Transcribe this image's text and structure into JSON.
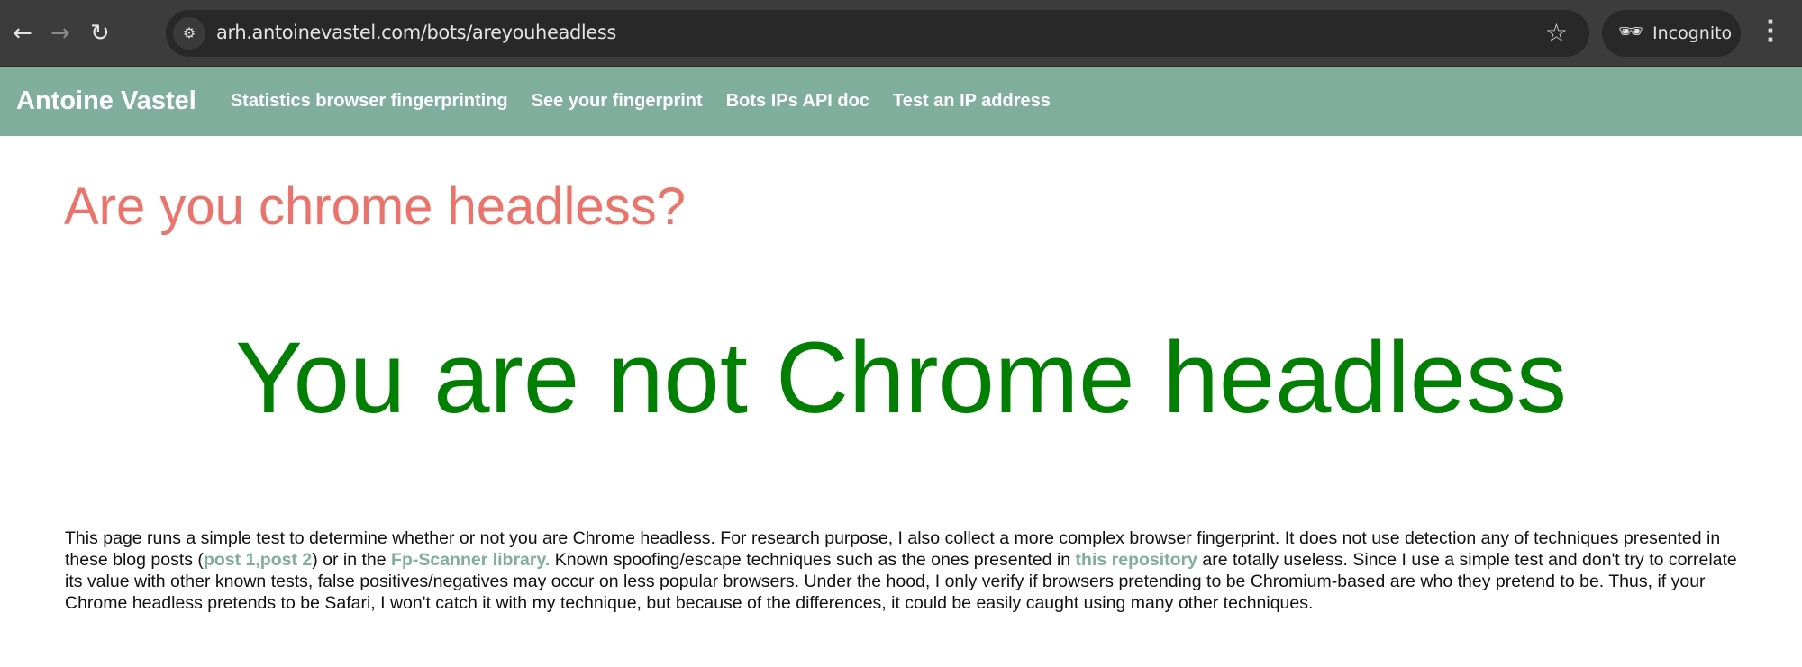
{
  "browser": {
    "url": "arh.antoinevastel.com/bots/areyouheadless",
    "profile_label": "Incognito"
  },
  "site_nav": {
    "brand": "Antoine Vastel",
    "links": [
      "Statistics browser fingerprinting",
      "See your fingerprint",
      "Bots IPs API doc",
      "Test an IP address"
    ]
  },
  "main": {
    "title": "Are you chrome headless?",
    "result": "You are not Chrome headless",
    "result_color": "#008000",
    "paragraph": {
      "t1": "This page runs a simple test to determine whether or not you are Chrome headless. For research purpose, I also collect a more complex browser fingerprint. It does not use detection any of techniques presented in these blog posts (",
      "link1": "post 1",
      "sep": ",",
      "link2": "post 2",
      "t2": ") or in the ",
      "link3": "Fp-Scanner library.",
      "t3": " Known spoofing/escape techniques such as the ones presented in ",
      "link4": "this repository",
      "t4": " are totally useless. Since I use a simple test and don't try to correlate its value with other known tests, false positives/negatives may occur on less popular browsers. Under the hood, I only verify if browsers pretending to be Chromium-based are who they pretend to be. Thus, if your Chrome headless pretends to be Safari, I won't catch it with my technique, but because of the differences, it could be easily caught using many other techniques."
    }
  },
  "colors": {
    "nav_bg": "#7faf9c",
    "title": "#f07167",
    "link": "#7faf9c"
  }
}
